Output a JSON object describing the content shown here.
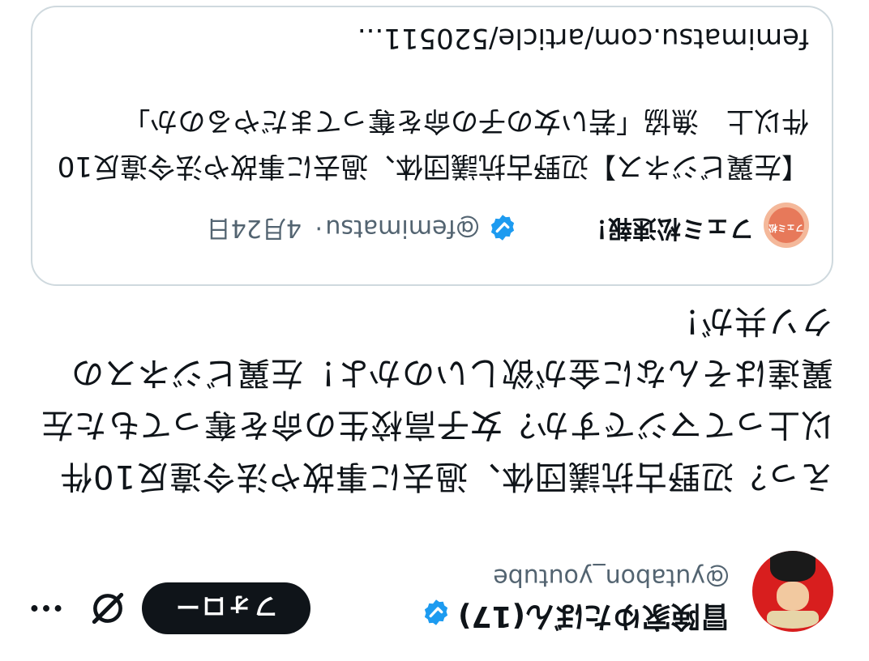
{
  "post": {
    "author": {
      "display_name": "冒険家ゆたぼん(17)",
      "handle": "@yutabon_youtube",
      "verified": true,
      "avatar_icon": "user-avatar"
    },
    "follow_label": "フォロー",
    "grok_icon": "grok-icon",
    "more_icon": "more-icon",
    "text": "えっ？辺野古抗議団体、過去に事故や法令違反10件以上ってマジですか？女子高校生の命を奪ってもた左翼達はそんなに金が欲しいのかよ！左翼ビジネスのクソ共が！"
  },
  "quote": {
    "author": {
      "display_name": "フェミ松速報！",
      "handle": "@femimatsu",
      "verified": true,
      "avatar_text": "フェミ松"
    },
    "separator": "·",
    "time": "4月24日",
    "text": "【左翼ビジネス】辺野古抗議団体、過去に事故や法令違反10件以上　漁協「若い女の子の命を奪ってまだやるのか」",
    "link": "femimatsu.com/article/520511..."
  },
  "colors": {
    "text": "#0f1419",
    "secondary": "#536471",
    "verified_blue": "#1d9bf0",
    "border": "#cfd9de",
    "button_bg": "#0f1419",
    "button_text": "#ffffff"
  }
}
